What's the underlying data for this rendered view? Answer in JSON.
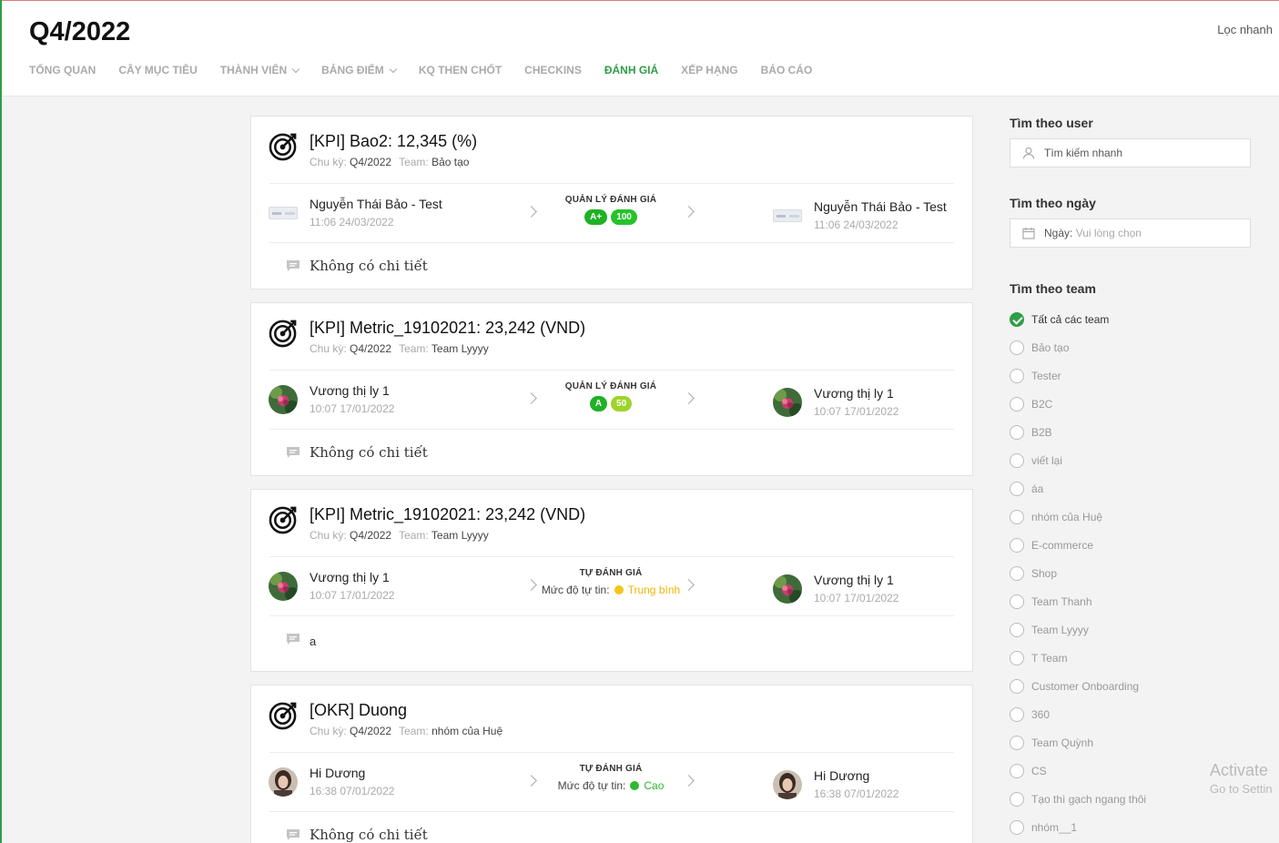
{
  "header": {
    "title": "Q4/2022",
    "quick_filter": "Lọc nhanh",
    "nav": [
      {
        "label": "TỔNG QUAN",
        "dropdown": false,
        "active": false
      },
      {
        "label": "CÂY MỤC TIÊU",
        "dropdown": false,
        "active": false
      },
      {
        "label": "THÀNH VIÊN",
        "dropdown": true,
        "active": false
      },
      {
        "label": "BẢNG ĐIỂM",
        "dropdown": true,
        "active": false
      },
      {
        "label": "KQ THEN CHỐT",
        "dropdown": false,
        "active": false
      },
      {
        "label": "CHECKINS",
        "dropdown": false,
        "active": false
      },
      {
        "label": "ĐÁNH GIÁ",
        "dropdown": false,
        "active": true
      },
      {
        "label": "XẾP HẠNG",
        "dropdown": false,
        "active": false
      },
      {
        "label": "BÁO CÁO",
        "dropdown": false,
        "active": false
      }
    ]
  },
  "labels": {
    "cycle_key": "Chu kỳ:",
    "team_key": "Team:"
  },
  "cards": [
    {
      "title": "[KPI] Bao2: 12,345 (%)",
      "cycle": "Q4/2022",
      "team": "Bảo tạo",
      "left": {
        "name": "Nguyễn Thái Bảo - Test",
        "time": "11:06 24/03/2022",
        "avatar": "flat"
      },
      "right": {
        "name": "Nguyễn Thái Bảo - Test",
        "time": "11:06 24/03/2022",
        "avatar": "flat"
      },
      "mid_label": "QUẢN LÝ ĐÁNH GIÁ",
      "grade": "A+",
      "score": "100",
      "score_color": "#26c22b",
      "comment": "Không có chi tiết",
      "comment_plain": false
    },
    {
      "title": "[KPI] Metric_19102021: 23,242 (VND)",
      "cycle": "Q4/2022",
      "team": "Team Lyyyy",
      "left": {
        "name": "Vương thị ly 1",
        "time": "10:07 17/01/2022",
        "avatar": "flower"
      },
      "right": {
        "name": "Vương thị ly 1",
        "time": "10:07 17/01/2022",
        "avatar": "flower"
      },
      "mid_label": "QUẢN LÝ ĐÁNH GIÁ",
      "grade": "A",
      "score": "50",
      "score_color": "#9ed42a",
      "comment": "Không có chi tiết",
      "comment_plain": false
    },
    {
      "title": "[KPI] Metric_19102021: 23,242 (VND)",
      "cycle": "Q4/2022",
      "team": "Team Lyyyy",
      "left": {
        "name": "Vương thị ly 1",
        "time": "10:07 17/01/2022",
        "avatar": "flower"
      },
      "right": {
        "name": "Vương thị ly 1",
        "time": "10:07 17/01/2022",
        "avatar": "flower"
      },
      "mid_label": "TỰ ĐÁNH GIÁ",
      "confidence_label": "Mức độ tự tin:",
      "confidence": "Trung bình",
      "confidence_color": "#f5c518",
      "comment": "a",
      "comment_plain": true
    },
    {
      "title": "[OKR] Duong",
      "cycle": "Q4/2022",
      "team": "nhóm của Huệ",
      "left": {
        "name": "Hi Dương",
        "time": "16:38 07/01/2022",
        "avatar": "portrait"
      },
      "right": {
        "name": "Hi Dương",
        "time": "16:38 07/01/2022",
        "avatar": "portrait"
      },
      "mid_label": "TỰ ĐÁNH GIÁ",
      "confidence_label": "Mức độ tự tin:",
      "confidence": "Cao",
      "confidence_color": "#2eb82e",
      "comment": "Không có chi tiết",
      "comment_plain": false
    }
  ],
  "sidebar": {
    "user_title": "Tìm theo user",
    "user_placeholder": "Tìm kiếm nhanh",
    "date_title": "Tìm theo ngày",
    "date_label": "Ngày:",
    "date_placeholder": "Vui lòng chọn",
    "team_title": "Tìm theo team",
    "teams": [
      {
        "label": "Tất cả các team",
        "checked": true
      },
      {
        "label": "Bảo tạo",
        "checked": false
      },
      {
        "label": "Tester",
        "checked": false
      },
      {
        "label": "B2C",
        "checked": false
      },
      {
        "label": "B2B",
        "checked": false
      },
      {
        "label": "viết lại",
        "checked": false
      },
      {
        "label": "áa",
        "checked": false
      },
      {
        "label": "nhóm của Huệ",
        "checked": false
      },
      {
        "label": "E-commerce",
        "checked": false
      },
      {
        "label": "Shop",
        "checked": false
      },
      {
        "label": "Team Thanh",
        "checked": false
      },
      {
        "label": "Team Lyyyy",
        "checked": false
      },
      {
        "label": "T Team",
        "checked": false
      },
      {
        "label": "Customer Onboarding",
        "checked": false
      },
      {
        "label": "360",
        "checked": false
      },
      {
        "label": "Team Quỳnh",
        "checked": false
      },
      {
        "label": "CS",
        "checked": false
      },
      {
        "label": "Tạo thì gạch ngang thôi",
        "checked": false
      },
      {
        "label": "nhóm__1",
        "checked": false
      }
    ]
  },
  "watermark": {
    "line1": "Activate",
    "line2": "Go to Settin"
  },
  "colors": {
    "accent": "#2e9e48",
    "grade_badge": "#1fb125"
  }
}
